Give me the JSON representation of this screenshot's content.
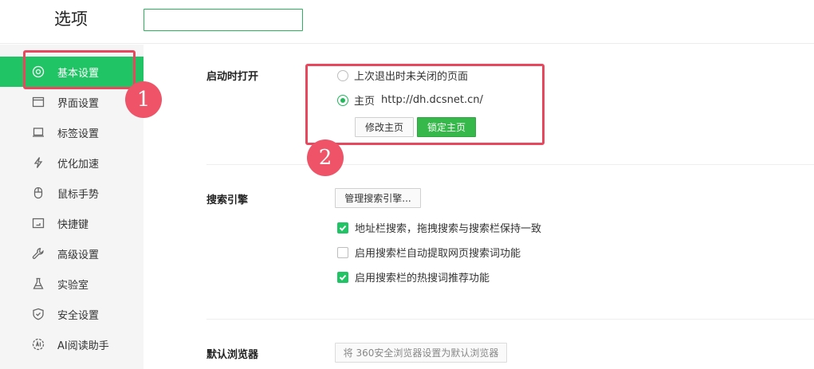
{
  "header": {
    "title": "选项",
    "search_value": ""
  },
  "sidebar": {
    "items": [
      {
        "label": "基本设置",
        "icon": "gear-icon",
        "active": true
      },
      {
        "label": "界面设置",
        "icon": "window-icon",
        "active": false
      },
      {
        "label": "标签设置",
        "icon": "tab-icon",
        "active": false
      },
      {
        "label": "优化加速",
        "icon": "lightning-icon",
        "active": false
      },
      {
        "label": "鼠标手势",
        "icon": "mouse-icon",
        "active": false
      },
      {
        "label": "快捷键",
        "icon": "keyboard-icon",
        "active": false
      },
      {
        "label": "高级设置",
        "icon": "wrench-icon",
        "active": false
      },
      {
        "label": "实验室",
        "icon": "flask-icon",
        "active": false
      },
      {
        "label": "安全设置",
        "icon": "shield-icon",
        "active": false
      },
      {
        "label": "AI阅读助手",
        "icon": "ai-reader-icon",
        "active": false
      }
    ]
  },
  "startup": {
    "label": "启动时打开",
    "option_restore": "上次退出时未关闭的页面",
    "option_home": "主页",
    "home_url": "http://dh.dcsnet.cn/",
    "selected": "home",
    "modify_button": "修改主页",
    "lock_button": "锁定主页"
  },
  "search": {
    "label": "搜索引擎",
    "manage_button": "管理搜索引擎...",
    "options": [
      {
        "label": "地址栏搜索，拖拽搜索与搜索栏保持一致",
        "checked": true
      },
      {
        "label": "启用搜索栏自动提取网页搜索词功能",
        "checked": false
      },
      {
        "label": "启用搜索栏的热搜词推荐功能",
        "checked": true
      }
    ]
  },
  "default_browser": {
    "label": "默认浏览器",
    "button": "将 360安全浏览器设置为默认浏览器"
  },
  "annotations": {
    "marker_1": "1",
    "marker_2": "2",
    "color": "#e8485d"
  },
  "colors": {
    "accent": "#20c464",
    "primary_button": "#36b84a"
  }
}
